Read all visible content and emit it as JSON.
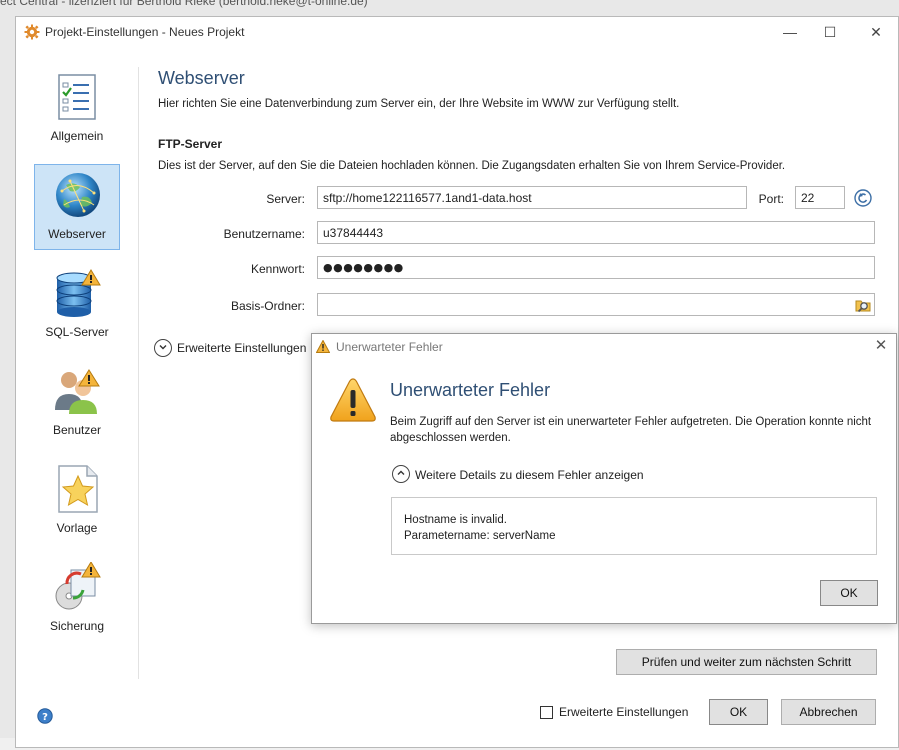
{
  "background": {
    "title_fragment": "ect Central - lizenziert für Berthold Rieke (berthold.rieke@t-online.de)"
  },
  "window": {
    "title": "Projekt-Einstellungen - Neues Projekt",
    "controls": {
      "minimize": "—",
      "maximize": "☐",
      "close": "✕"
    }
  },
  "sidebar": {
    "items": [
      {
        "label": "Allgemein",
        "icon": "checklist-icon",
        "selected": false
      },
      {
        "label": "Webserver",
        "icon": "globe-icon",
        "selected": true
      },
      {
        "label": "SQL-Server",
        "icon": "database-warning-icon",
        "selected": false
      },
      {
        "label": "Benutzer",
        "icon": "users-warning-icon",
        "selected": false
      },
      {
        "label": "Vorlage",
        "icon": "star-page-icon",
        "selected": false
      },
      {
        "label": "Sicherung",
        "icon": "backup-warning-icon",
        "selected": false
      }
    ]
  },
  "main": {
    "heading": "Webserver",
    "description": "Hier richten Sie eine Datenverbindung zum Server ein, der Ihre Website im WWW zur Verfügung stellt.",
    "section_title": "FTP-Server",
    "section_description": "Dies ist der Server, auf den Sie die Dateien hochladen können. Die Zugangsdaten erhalten Sie von Ihrem Service-Provider.",
    "fields": {
      "server_label": "Server:",
      "server_value": "sftp://home122116577.1and1-data.host",
      "port_label": "Port:",
      "port_value": "22",
      "username_label": "Benutzername:",
      "username_value": "u37844443",
      "password_label": "Kennwort:",
      "password_value": "●●●●●●●●",
      "folder_label": "Basis-Ordner:",
      "folder_value": ""
    },
    "advanced_toggle": "Erweiterte Einstellungen",
    "check_button": "Prüfen und weiter zum nächsten Schritt"
  },
  "footer": {
    "advanced_checkbox_label": "Erweiterte Einstellungen",
    "advanced_checked": false,
    "ok_button": "OK",
    "cancel_button": "Abbrechen"
  },
  "dialog": {
    "title": "Unerwarteter Fehler",
    "heading": "Unerwarteter Fehler",
    "message": "Beim Zugriff auf den Server ist ein unerwarteter Fehler aufgetreten. Die Operation konnte nicht abgeschlossen werden.",
    "details_toggle": "Weitere Details zu diesem Fehler anzeigen",
    "details_line1": "Hostname is invalid.",
    "details_line2": "Parametername: serverName",
    "ok_button": "OK",
    "close": "✕"
  },
  "colors": {
    "heading_blue": "#2f4f74",
    "selection_fill": "#cde4f7",
    "selection_border": "#7eb4ea",
    "warning_yellow": "#f4b43b"
  }
}
